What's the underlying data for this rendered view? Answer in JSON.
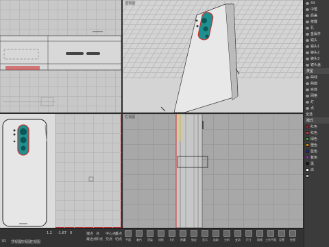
{
  "viewports": {
    "top_title": "",
    "persp_title": "透视图",
    "front_title": "",
    "right_title": "右视图"
  },
  "side_panel": {
    "layers": [
      "44",
      "中框",
      "后盖",
      "按键",
      "孔",
      "金属件",
      "镜头",
      "镜头1",
      "镜头2",
      "镜头3",
      "镜头盖"
    ],
    "section2_title": "类型",
    "types": [
      "曲线",
      "曲面",
      "实体",
      "网格",
      "灯",
      "点"
    ],
    "select_all": "全选",
    "section3_title": "模式",
    "swatch_colors": [
      "#b22",
      "#d33",
      "#3a3",
      "#e80",
      "#228",
      "#a3c",
      "#111",
      "#fff",
      "#bbb"
    ],
    "swatch_labels": [
      "红色",
      "红色",
      "绿色",
      "橙色",
      "蓝色",
      "紫色",
      "黑",
      "白",
      ""
    ]
  },
  "bottom": {
    "viewport_tabs": [
      "3D",
      "顶视图",
      "前视图",
      "右视图"
    ],
    "coords": [
      "1.2",
      "-1.67",
      "0"
    ],
    "snap_labels": [
      "端点",
      "最近点",
      "点",
      "中点",
      "中心点",
      "交点",
      "垂点",
      "切点"
    ],
    "tools": [
      "平面",
      "着色",
      "渲染",
      "线框",
      "X光",
      "隐藏",
      "锁定",
      "显示",
      "选取",
      "分析",
      "变动",
      "尺寸",
      "网格",
      "工作平面",
      "设置",
      "绘图"
    ]
  }
}
